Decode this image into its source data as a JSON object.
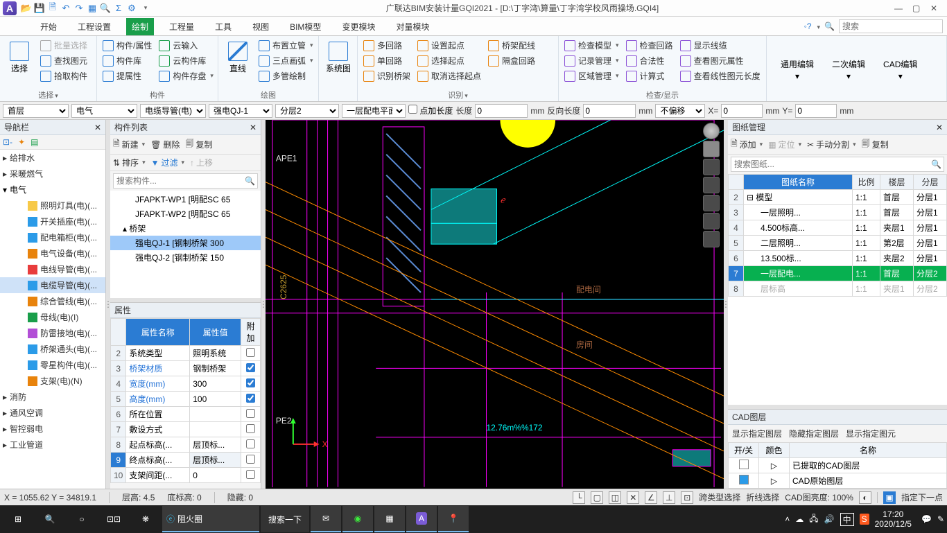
{
  "title": "广联达BIM安装计量GQI2021 - [D:\\丁字湾\\算量\\丁字湾学校风雨操场.GQI4]",
  "tabs": [
    "开始",
    "工程设置",
    "绘制",
    "工程量",
    "工具",
    "视图",
    "BIM模型",
    "变更模块",
    "对量模块"
  ],
  "active_tab": "绘制",
  "search_placeholder": "搜索",
  "ribbon": {
    "select": {
      "label": "选择",
      "items": [
        "批量选择",
        "查找图元",
        "拾取构件"
      ],
      "big": "选择"
    },
    "component": {
      "label": "构件",
      "items": [
        "构件/属性",
        "构件库",
        "提属性",
        "云输入",
        "云构件库",
        "构件存盘"
      ]
    },
    "draw": {
      "label": "绘图",
      "big": "直线",
      "items": [
        "布置立管",
        "三点画弧",
        "多管绘制"
      ]
    },
    "sysdwg": {
      "label": "",
      "big": "系统图"
    },
    "recog": {
      "label": "识别",
      "items": [
        "多回路",
        "单回路",
        "识别桥架",
        "设置起点",
        "选择起点",
        "取消选择起点",
        "桥架配线",
        "隔盒回路"
      ]
    },
    "check": {
      "label": "检查/显示",
      "items": [
        "检查模型",
        "记录管理",
        "区域管理",
        "检查回路",
        "合法性",
        "计算式",
        "显示线缆",
        "查看图元属性",
        "查看线性图元长度"
      ]
    },
    "edits": [
      "通用编辑",
      "二次编辑",
      "CAD编辑"
    ]
  },
  "optbar": {
    "floor": "首层",
    "major": "电气",
    "type": "电缆导管(电)",
    "comp": "强电QJ-1",
    "layer": "分层2",
    "plan": "一层配电平面图",
    "ptlen": "点加长度",
    "len_lbl": "长度",
    "len": "0",
    "len_u": "mm",
    "rlen_lbl": "反向长度",
    "rlen": "0",
    "rlen_u": "mm",
    "offset": "不偏移",
    "x_lbl": "X=",
    "x": "0",
    "x_u": "mm",
    "y_lbl": "Y=",
    "y": "0",
    "y_u": "mm"
  },
  "nav": {
    "title": "导航栏",
    "groups": [
      "给排水",
      "采暖燃气",
      "电气",
      "消防",
      "通风空调",
      "智控弱电",
      "工业管道"
    ],
    "elec_items": [
      "照明灯具(电)(...",
      "开关插座(电)(...",
      "配电箱柜(电)(...",
      "电气设备(电)(...",
      "电线导管(电)(...",
      "电缆导管(电)(...",
      "综合管线(电)(...",
      "母线(电)(I)",
      "防雷接地(电)(...",
      "桥架通头(电)(...",
      "零星构件(电)(...",
      "支架(电)(N)"
    ],
    "selected": "电缆导管(电)(..."
  },
  "complist": {
    "title": "构件列表",
    "tb": [
      "新建",
      "删除",
      "复制",
      "排序",
      "过滤",
      "上移"
    ],
    "search": "搜索构件...",
    "rows": [
      "JFAPKT-WP1 [明配SC 65",
      "JFAPKT-WP2 [明配SC 65"
    ],
    "group": "桥架",
    "sub": [
      "强电QJ-1 [钢制桥架 300",
      "强电QJ-2 [钢制桥架 150"
    ],
    "selected": "强电QJ-1 [钢制桥架 300"
  },
  "props": {
    "title": "属性",
    "headers": [
      "属性名称",
      "属性值",
      "附加"
    ],
    "rows": [
      {
        "n": "2",
        "name": "系统类型",
        "val": "照明系统",
        "chk": false
      },
      {
        "n": "3",
        "name": "桥架材质",
        "val": "钢制桥架",
        "chk": true,
        "link": true
      },
      {
        "n": "4",
        "name": "宽度(mm)",
        "val": "300",
        "chk": true,
        "link": true
      },
      {
        "n": "5",
        "name": "高度(mm)",
        "val": "100",
        "chk": true,
        "link": true
      },
      {
        "n": "6",
        "name": "所在位置",
        "val": "",
        "chk": false
      },
      {
        "n": "7",
        "name": "敷设方式",
        "val": "",
        "chk": false
      },
      {
        "n": "8",
        "name": "起点标高(...",
        "val": "层顶标...",
        "chk": false
      },
      {
        "n": "9",
        "name": "终点标高(...",
        "val": "层顶标...",
        "chk": false,
        "sel": true
      },
      {
        "n": "10",
        "name": "支架间距(...",
        "val": "0",
        "chk": false
      }
    ]
  },
  "dwgmgr": {
    "title": "图纸管理",
    "tb": [
      "添加",
      "定位",
      "手动分割",
      "复制"
    ],
    "search": "搜索图纸...",
    "headers": [
      "",
      "图纸名称",
      "比例",
      "楼层",
      "分层"
    ],
    "rows": [
      {
        "n": "2",
        "name": "模型",
        "ratio": "1:1",
        "floor": "首层",
        "layer": "分层1",
        "tree": true
      },
      {
        "n": "3",
        "name": "一层照明...",
        "ratio": "1:1",
        "floor": "首层",
        "layer": "分层1"
      },
      {
        "n": "4",
        "name": "4.500标高...",
        "ratio": "1:1",
        "floor": "夹层1",
        "layer": "分层1"
      },
      {
        "n": "5",
        "name": "二层照明...",
        "ratio": "1:1",
        "floor": "第2层",
        "layer": "分层1"
      },
      {
        "n": "6",
        "name": "13.500标...",
        "ratio": "1:1",
        "floor": "夹层2",
        "layer": "分层1"
      },
      {
        "n": "7",
        "name": "一层配电...",
        "ratio": "1:1",
        "floor": "首层",
        "layer": "分层2",
        "sel": true
      },
      {
        "n": "8",
        "name": "层标高",
        "ratio": "1:1",
        "floor": "夹层1",
        "layer": "分层2",
        "dim": true
      }
    ]
  },
  "cadlayer": {
    "title": "CAD图层",
    "tabs": [
      "显示指定图层",
      "隐藏指定图层",
      "显示指定图元"
    ],
    "headers": [
      "开/关",
      "颜色",
      "名称"
    ],
    "rows": [
      {
        "on": false,
        "name": "已提取的CAD图层"
      },
      {
        "on": true,
        "name": "CAD原始图层"
      }
    ]
  },
  "cad_text": {
    "ape1": "APE1",
    "pe2": "PE2",
    "c2625": "C2625",
    "room1": "配电间",
    "room2": "房间",
    "dim": "12.76m%%172",
    "cursor": "ℯ"
  },
  "status": {
    "coord": "X = 1055.62 Y = 34819.1",
    "floorh": "层高:  4.5",
    "baseh": "底标高:  0",
    "hidden": "隐藏:  0",
    "cross": "跨类型选择",
    "poly": "折线选择",
    "bright": "CAD图亮度:  100%",
    "hint": "指定下一点"
  },
  "taskbar": {
    "search": "搜索一下",
    "app": "阻火圈",
    "time": "17:20",
    "date": "2020/12/5",
    "ime": "中"
  }
}
